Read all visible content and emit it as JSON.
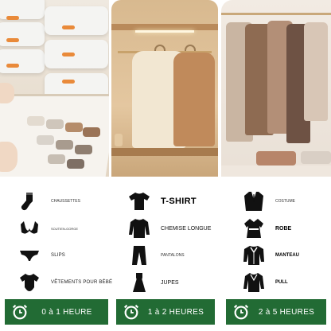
{
  "photos": [
    {
      "name": "storage-drawers-photo"
    },
    {
      "name": "wardrobe-photo"
    },
    {
      "name": "closet-photo"
    }
  ],
  "columns": [
    {
      "items": [
        {
          "icon": "sock-icon",
          "label": "CHAUSSETTES"
        },
        {
          "icon": "bra-icon",
          "label": "SOUTIEN-GORGE"
        },
        {
          "icon": "briefs-icon",
          "label": "SLIPS"
        },
        {
          "icon": "baby-bodysuit-icon",
          "label": "VÊTEMENTS POUR BÉBÉ"
        }
      ],
      "time": {
        "label": "0 à 1 HEURE",
        "icon": "alarm-clock-icon"
      }
    },
    {
      "items": [
        {
          "icon": "tshirt-icon",
          "label": "T-SHIRT"
        },
        {
          "icon": "long-sleeve-shirt-icon",
          "label": "CHEMISE LONGUE"
        },
        {
          "icon": "trousers-icon",
          "label": "PANTALONS"
        },
        {
          "icon": "skirt-dress-icon",
          "label": "JUPES"
        }
      ],
      "time": {
        "label": "1 à 2 HEURES",
        "icon": "alarm-clock-icon"
      }
    },
    {
      "items": [
        {
          "icon": "suit-icon",
          "label": "COSTUME"
        },
        {
          "icon": "robe-icon",
          "label": "ROBE"
        },
        {
          "icon": "coat-icon",
          "label": "MANTEAU"
        },
        {
          "icon": "sweater-icon",
          "label": "PULL"
        }
      ],
      "time": {
        "label": "2 à 5 HEURES",
        "icon": "alarm-clock-icon"
      }
    }
  ],
  "colors": {
    "button_green": "#226b34",
    "tab_orange": "#e98a3a",
    "text_dark": "#111111"
  }
}
